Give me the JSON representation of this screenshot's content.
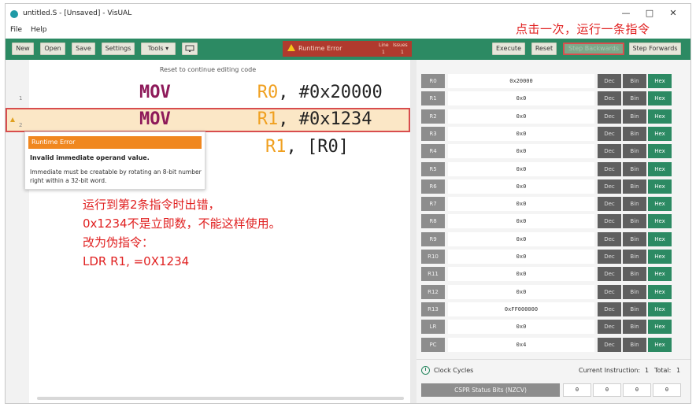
{
  "window": {
    "title": "untitled.S - [Unsaved] - VisUAL",
    "controls": {
      "minimize": "—",
      "maximize": "□",
      "close": "✕"
    }
  },
  "menu": [
    "File",
    "Help"
  ],
  "toolbar": {
    "new": "New",
    "open": "Open",
    "save": "Save",
    "settings": "Settings",
    "tools": "Tools ▾",
    "error_text": "Runtime Error",
    "error_line_label": "Line",
    "error_issues_label": "Issues",
    "error_line": "1",
    "error_issues": "1",
    "execute": "Execute",
    "reset": "Reset",
    "step_backwards": "Step Backwards",
    "step_forwards": "Step Forwards"
  },
  "annotations": {
    "top": "点击一次，运行一条指令",
    "middle": [
      "运行到第2条指令时出错，",
      "0x1234不是立即数，不能这样使用。",
      "改为伪指令：",
      "LDR  R1, =0X1234"
    ]
  },
  "editor": {
    "reset_hint": "Reset to continue editing code",
    "lines": [
      {
        "num": "1",
        "op": "MOV",
        "reg": "R0",
        "rest": ", #0x20000"
      },
      {
        "num": "2",
        "op": "MOV",
        "reg": "R1",
        "rest": ", #0x1234"
      },
      {
        "num": "",
        "op": "",
        "reg": "R1",
        "rest": ", [R0]"
      }
    ]
  },
  "tooltip": {
    "header": "Runtime Error",
    "title": "Invalid immediate operand value.",
    "body": "Immediate must be creatable by rotating an 8-bit number right within a 32-bit word."
  },
  "registers": [
    {
      "name": "R0",
      "value": "0x20000"
    },
    {
      "name": "R1",
      "value": "0x0"
    },
    {
      "name": "R2",
      "value": "0x0"
    },
    {
      "name": "R3",
      "value": "0x0"
    },
    {
      "name": "R4",
      "value": "0x0"
    },
    {
      "name": "R5",
      "value": "0x0"
    },
    {
      "name": "R6",
      "value": "0x0"
    },
    {
      "name": "R7",
      "value": "0x0"
    },
    {
      "name": "R8",
      "value": "0x0"
    },
    {
      "name": "R9",
      "value": "0x0"
    },
    {
      "name": "R10",
      "value": "0x0"
    },
    {
      "name": "R11",
      "value": "0x0"
    },
    {
      "name": "R12",
      "value": "0x0"
    },
    {
      "name": "R13",
      "value": "0xFF000000"
    },
    {
      "name": "LR",
      "value": "0x0"
    },
    {
      "name": "PC",
      "value": "0x4"
    }
  ],
  "format_buttons": {
    "dec": "Dec",
    "bin": "Bin",
    "hex": "Hex"
  },
  "status": {
    "clock_cycles_label": "Clock Cycles",
    "current_instruction_label": "Current Instruction:",
    "current_instruction": "1",
    "total_label": "Total:",
    "total": "1",
    "cpsr_label": "CSPR Status Bits (NZCV)",
    "flags": [
      "0",
      "0",
      "0",
      "0"
    ]
  },
  "colors": {
    "toolbar_green": "#2c8a63",
    "error_red": "#b03a2e",
    "annotation_red": "#e02020",
    "tooltip_orange": "#f0871f"
  }
}
